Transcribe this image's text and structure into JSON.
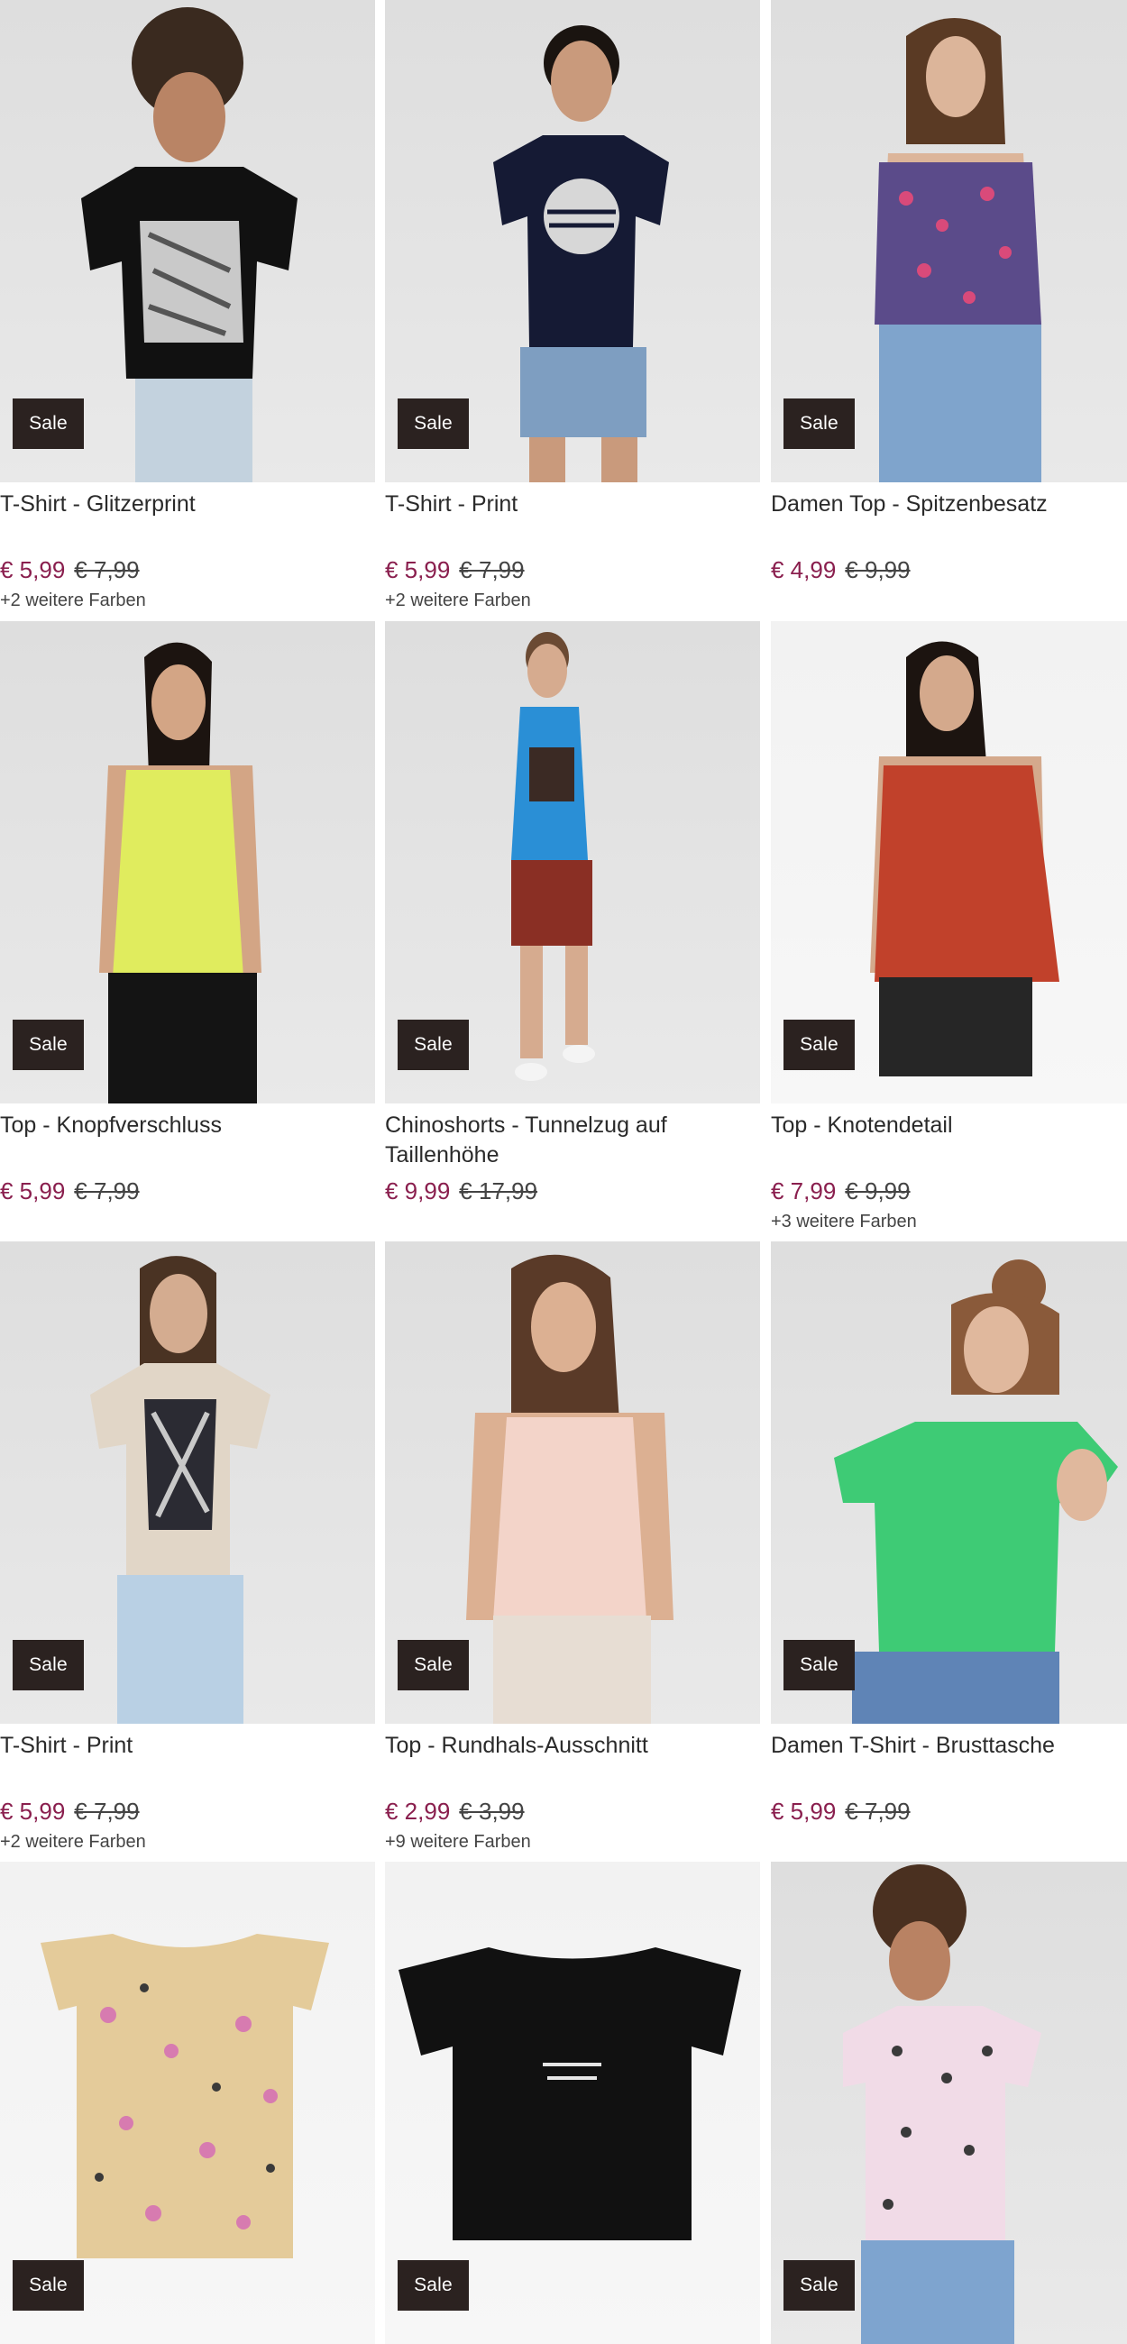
{
  "sale_label": "Sale",
  "colors": {
    "price": "#8a1f4e",
    "sale_badge": "#2b2220"
  },
  "products": [
    {
      "title": "T-Shirt - Glitzerprint",
      "price": "€ 5,99",
      "old_price": "€ 7,99",
      "more_colors": "+2 weitere Farben",
      "image": "woman-black-glitter-tshirt"
    },
    {
      "title": "T-Shirt - Print",
      "price": "€ 5,99",
      "old_price": "€ 7,99",
      "more_colors": "+2 weitere Farben",
      "image": "woman-navy-print-tshirt"
    },
    {
      "title": "Damen Top - Spitzenbesatz",
      "price": "€ 4,99",
      "old_price": "€ 9,99",
      "more_colors": "",
      "image": "woman-floral-lace-top"
    },
    {
      "title": "Top - Knopfverschluss",
      "price": "€ 5,99",
      "old_price": "€ 7,99",
      "more_colors": "",
      "image": "woman-yellow-tank-top"
    },
    {
      "title": "Chinoshorts - Tunnelzug auf Taillenhöhe",
      "price": "€ 9,99",
      "old_price": "€ 17,99",
      "more_colors": "",
      "image": "man-red-chino-shorts"
    },
    {
      "title": "Top - Knotendetail",
      "price": "€ 7,99",
      "old_price": "€ 9,99",
      "more_colors": "+3 weitere Farben",
      "image": "woman-red-knot-top"
    },
    {
      "title": "T-Shirt - Print",
      "price": "€ 5,99",
      "old_price": "€ 7,99",
      "more_colors": "+2 weitere Farben",
      "image": "woman-beige-print-tshirt"
    },
    {
      "title": "Top - Rundhals-Ausschnitt",
      "price": "€ 2,99",
      "old_price": "€ 3,99",
      "more_colors": "+9 weitere Farben",
      "image": "woman-pink-tank-top"
    },
    {
      "title": "Damen T-Shirt - Brusttasche",
      "price": "€ 5,99",
      "old_price": "€ 7,99",
      "more_colors": "",
      "image": "woman-green-pocket-tshirt"
    },
    {
      "title": "",
      "price": "",
      "old_price": "",
      "more_colors": "",
      "image": "beige-patterned-kids-tshirt"
    },
    {
      "title": "",
      "price": "",
      "old_price": "",
      "more_colors": "",
      "image": "black-print-tshirt"
    },
    {
      "title": "",
      "price": "",
      "old_price": "",
      "more_colors": "",
      "image": "woman-pink-butterfly-tshirt"
    }
  ]
}
